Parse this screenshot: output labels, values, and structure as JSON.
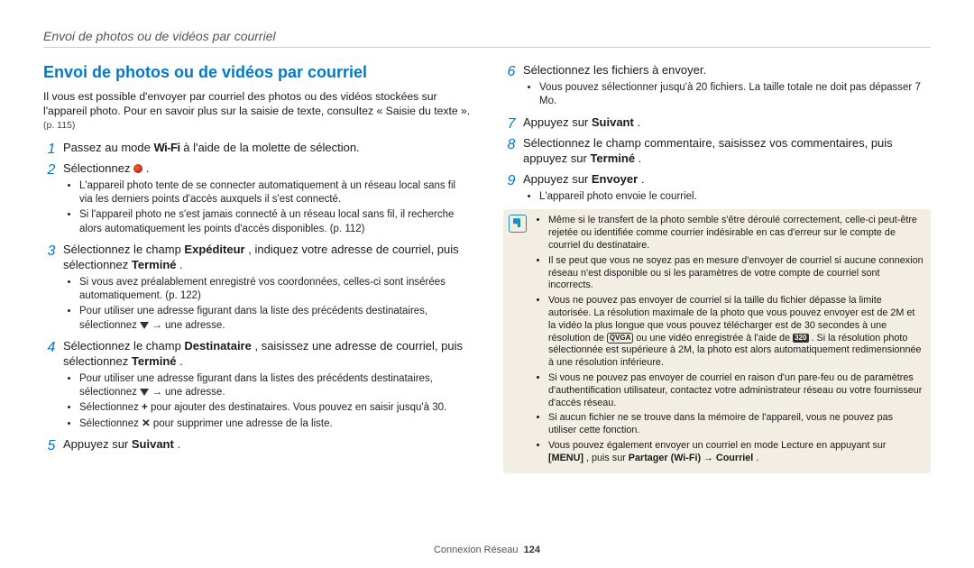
{
  "running_head": "Envoi de photos ou de vidéos par courriel",
  "title": "Envoi de photos ou de vidéos par courriel",
  "intro": "Il vous est possible d'envoyer par courriel des photos ou des vidéos stockées sur l'appareil photo. Pour en savoir plus sur la saisie de texte, consultez « Saisie du texte ».",
  "intro_ref": "(p. 115)",
  "wifi_label": "Wi-Fi",
  "qvga_label": "QVGA",
  "res320_label": "320",
  "steps_left": {
    "1": {
      "pre": "Passez au mode ",
      "post": " à l'aide de la molette de sélection."
    },
    "2": {
      "pre": "Sélectionnez ",
      "post": " .",
      "sub": [
        "L'appareil photo tente de se connecter automatiquement à un réseau local sans fil via les derniers points d'accès auxquels il s'est connecté.",
        "Si l'appareil photo ne s'est jamais connecté à un réseau local sans fil, il recherche alors automatiquement les points d'accès disponibles. (p. 112)"
      ]
    },
    "3": {
      "main_a": "Sélectionnez le champ ",
      "b1": "Expéditeur",
      "main_b": ", indiquez votre adresse de courriel, puis sélectionnez ",
      "b2": "Terminé",
      "main_c": ".",
      "sub_plain": "Si vous avez préalablement enregistré vos coordonnées, celles-ci sont insérées automatiquement. (p. 122)",
      "sub_tri": {
        "pre": "Pour utiliser une adresse figurant dans la liste des précédents destinataires, sélectionnez ",
        "post": " → une adresse."
      }
    },
    "4": {
      "main_a": "Sélectionnez le champ ",
      "b1": "Destinataire",
      "main_b": ", saisissez une adresse de courriel, puis sélectionnez ",
      "b2": "Terminé",
      "main_c": ".",
      "sub_tri": {
        "pre": "Pour utiliser une adresse figurant dans la listes des précédents destinataires, sélectionnez ",
        "post": " → une adresse."
      },
      "sub_plus": {
        "pre": "Sélectionnez ",
        "post": " pour ajouter des destinataires. Vous pouvez en saisir jusqu'à 30."
      },
      "sub_x": {
        "pre": "Sélectionnez ",
        "post": " pour supprimer une adresse de la liste."
      }
    },
    "5": {
      "pre": "Appuyez sur ",
      "b": "Suivant",
      "post": "."
    }
  },
  "steps_right": {
    "6": {
      "main": "Sélectionnez les fichiers à envoyer.",
      "sub": [
        "Vous pouvez sélectionner jusqu'à 20 fichiers. La taille totale ne doit pas dépasser 7 Mo."
      ]
    },
    "7": {
      "pre": "Appuyez sur ",
      "b": "Suivant",
      "post": "."
    },
    "8": {
      "pre": "Sélectionnez le champ commentaire, saisissez vos commentaires, puis appuyez sur ",
      "b": "Terminé",
      "post": "."
    },
    "9": {
      "pre": "Appuyez sur ",
      "b": "Envoyer",
      "post": ".",
      "sub": [
        "L'appareil photo envoie le courriel."
      ]
    }
  },
  "note": {
    "items": [
      "Même si le transfert de la photo semble s'être déroulé correctement, celle-ci peut-être rejetée ou identifiée comme courrier indésirable en cas d'erreur sur le compte de courriel du destinataire.",
      "Il se peut que vous ne soyez pas en mesure d'envoyer de courriel si aucune connexion réseau n'est disponible ou si les paramètres de votre compte de courriel sont incorrects."
    ],
    "long": {
      "a": "Vous ne pouvez pas envoyer de courriel si la taille du fichier dépasse la limite autorisée. La résolution maximale de la photo que vous pouvez envoyer est de 2M et la vidéo la plus longue que vous pouvez télécharger est de 30 secondes à une résolution de ",
      "b": " ou une vidéo enregistrée à l'aide de ",
      "c": ". Si la résolution photo sélectionnée est supérieure à 2M, la photo est alors automatiquement redimensionnée à une résolution inférieure."
    },
    "items2": [
      "Si vous ne pouvez pas envoyer de courriel en raison d'un pare-feu ou de paramètres d'authentification utilisateur, contactez votre administrateur réseau ou votre fournisseur d'accès réseau.",
      "Si aucun fichier ne se trouve dans la mémoire de l'appareil, vous ne pouvez pas utiliser cette fonction."
    ],
    "last": {
      "a": "Vous pouvez également envoyer un courriel en mode Lecture en appuyant sur ",
      "menu": "[MENU]",
      "b": ", puis sur ",
      "share": "Partager (Wi-Fi)",
      "arrow": " → ",
      "mail": "Courriel",
      "dot": "."
    }
  },
  "footer": {
    "label": "Connexion Réseau",
    "page": "124"
  }
}
